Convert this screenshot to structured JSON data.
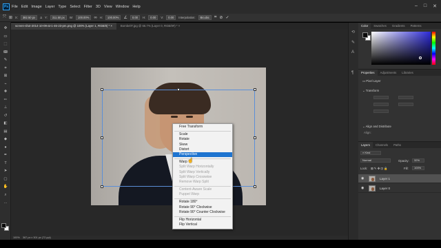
{
  "app": {
    "logo_text": "Ps"
  },
  "menu": [
    "File",
    "Edit",
    "Image",
    "Layer",
    "Type",
    "Select",
    "Filter",
    "3D",
    "View",
    "Window",
    "Help"
  ],
  "options_bar": {
    "x_label": "X:",
    "x_value": "382.50 px",
    "y_label": "Y:",
    "y_value": "311.50 px",
    "w_label": "W:",
    "w_value": "100.00%",
    "h_label": "H:",
    "h_value": "100.00%",
    "angle_value": "0.00",
    "h_skew_label": "H:",
    "h_skew_value": "0.00",
    "v_skew_label": "V:",
    "v_skew_value": "0.00",
    "interpolation_label": "Interpolation:",
    "interpolation_value": "Bicubic"
  },
  "tabs": [
    {
      "label": "screen-shot-2014-10-09-at-1-46-23-pm.png @ 100% (Layer 1, RGB/8) *",
      "active": true
    },
    {
      "label": "BombelIT.jpg @ 66.7% (Layer 0, RGB/8#) *",
      "active": false
    }
  ],
  "context_menu": {
    "items": [
      {
        "label": "Free Transform",
        "state": "normal"
      },
      {
        "sep": true
      },
      {
        "label": "Scale",
        "state": "normal"
      },
      {
        "label": "Rotate",
        "state": "normal"
      },
      {
        "label": "Skew",
        "state": "normal"
      },
      {
        "label": "Distort",
        "state": "normal"
      },
      {
        "label": "Perspective",
        "state": "selected"
      },
      {
        "sep": true
      },
      {
        "label": "Warp",
        "state": "normal"
      },
      {
        "label": "Split Warp Horizontally",
        "state": "disabled"
      },
      {
        "label": "Split Warp Vertically",
        "state": "disabled"
      },
      {
        "label": "Split Warp Crosswise",
        "state": "disabled"
      },
      {
        "label": "Remove Warp Split",
        "state": "disabled"
      },
      {
        "sep": true
      },
      {
        "label": "Content-Aware Scale",
        "state": "disabled"
      },
      {
        "label": "Puppet Warp",
        "state": "disabled"
      },
      {
        "sep": true
      },
      {
        "label": "Rotate 180°",
        "state": "normal"
      },
      {
        "label": "Rotate 90° Clockwise",
        "state": "normal"
      },
      {
        "label": "Rotate 90° Counter Clockwise",
        "state": "normal"
      },
      {
        "sep": true
      },
      {
        "label": "Flip Horizontal",
        "state": "normal"
      },
      {
        "label": "Flip Vertical",
        "state": "normal"
      }
    ]
  },
  "status_bar": {
    "zoom": "100%",
    "info": "367 px x 301 px (72 ppi)"
  },
  "color_panel": {
    "tabs": [
      "Color",
      "Swatches",
      "Gradients",
      "Patterns"
    ],
    "active_tab": "Color",
    "picker_hue": "#2d2bd8"
  },
  "properties_panel": {
    "tabs": [
      "Properties",
      "Adjustments",
      "Libraries"
    ],
    "active_tab": "Properties",
    "layer_type": "Pixel Layer",
    "transform_label": "Transform",
    "align_label": "Align and Distribute",
    "align_sub": "Align:"
  },
  "layers_panel": {
    "tabs": [
      "Layers",
      "Channels",
      "Paths"
    ],
    "active_tab": "Layers",
    "filter_label": "Kind",
    "blend_mode": "Normal",
    "opacity_label": "Opacity:",
    "opacity_value": "32%",
    "lock_label": "Lock:",
    "fill_label": "Fill:",
    "fill_value": "100%",
    "layers": [
      {
        "name": "Layer 1",
        "selected": true
      },
      {
        "name": "Layer 0",
        "selected": false
      }
    ]
  },
  "colors": {
    "accent": "#1e74d0",
    "transform_box": "#5a8ed8"
  }
}
